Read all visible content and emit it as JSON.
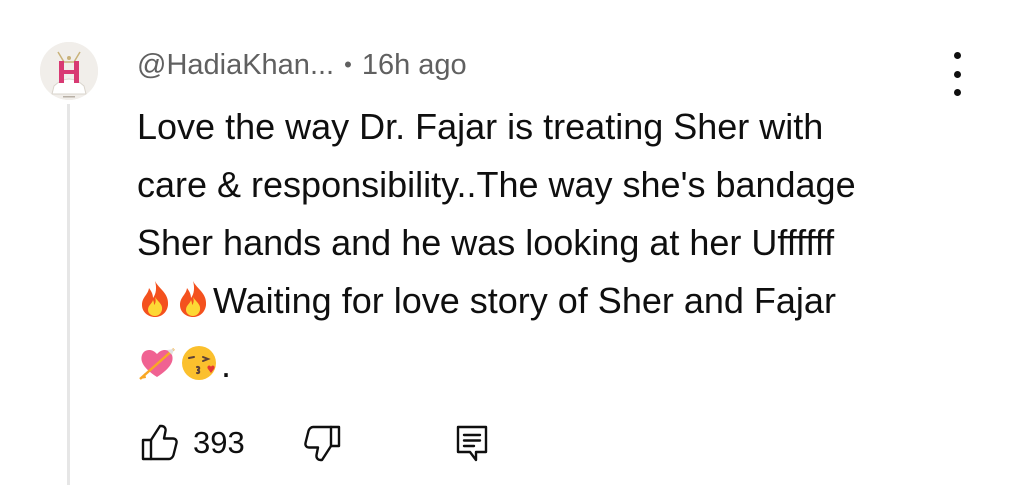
{
  "comment": {
    "author": "@HadiaKhan...",
    "separator": "•",
    "timestamp": "16h ago",
    "text_lines": [
      "Love the way Dr. Fajar is treating Sher with",
      "care & responsibility..The way she's bandage",
      "Sher hands and he was looking at her Uffffff",
      "Waiting for love story of Sher and Fajar",
      "."
    ],
    "emojis": {
      "fire_1": "fire-emoji",
      "fire_2": "fire-emoji",
      "heart": "heart-with-arrow-emoji",
      "kiss": "face-blowing-kiss-emoji"
    },
    "avatar_icon": "avatar-letter-h-icon"
  },
  "actions": {
    "like_icon": "thumbs-up-icon",
    "like_count": "393",
    "dislike_icon": "thumbs-down-icon",
    "reply_icon": "reply-comment-icon"
  },
  "menu": {
    "icon": "more-vert-icon"
  },
  "colors": {
    "text_primary": "#0f0f0f",
    "text_secondary": "#606060",
    "thread_line": "#e6e6e6",
    "avatar_bg": "#f1eeea",
    "avatar_letter": "#d83a73"
  }
}
